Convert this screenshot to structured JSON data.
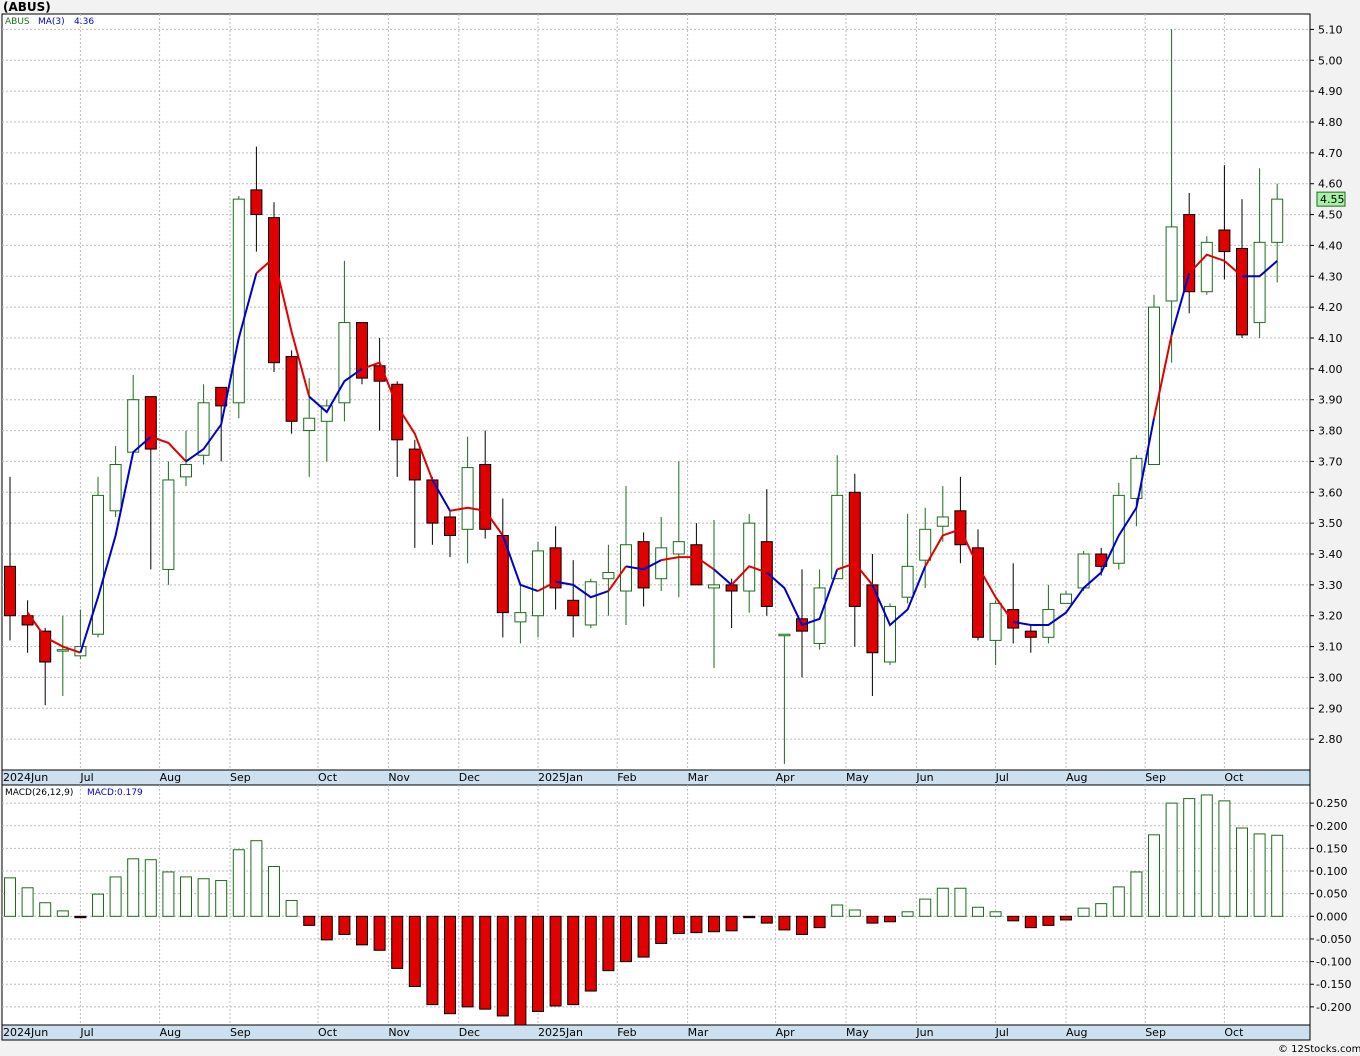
{
  "chart_data": [
    {
      "type": "candlestick",
      "title": "(ABUS)",
      "symbol_label": "ABUS",
      "ma_label": "MA(3)",
      "ma_value": "4.36",
      "last_price": "4.55",
      "interval": "weekly",
      "ylim": [
        2.7,
        5.15
      ],
      "y_ticks": [
        "2.80",
        "2.90",
        "3.00",
        "3.10",
        "3.20",
        "3.30",
        "3.40",
        "3.50",
        "3.60",
        "3.70",
        "3.80",
        "3.90",
        "4.00",
        "4.10",
        "4.20",
        "4.30",
        "4.40",
        "4.50",
        "4.60",
        "4.70",
        "4.80",
        "4.90",
        "5.00",
        "5.10"
      ],
      "months": [
        {
          "label": "2024Jun",
          "week": -0.5
        },
        {
          "label": "Jul",
          "week": 4
        },
        {
          "label": "Aug",
          "week": 8.5
        },
        {
          "label": "Sep",
          "week": 12.5
        },
        {
          "label": "Oct",
          "week": 17.5
        },
        {
          "label": "Nov",
          "week": 21.5
        },
        {
          "label": "Dec",
          "week": 25.5
        },
        {
          "label": "2025Jan",
          "week": 30
        },
        {
          "label": "Feb",
          "week": 34.5
        },
        {
          "label": "Mar",
          "week": 38.5
        },
        {
          "label": "Apr",
          "week": 43.5
        },
        {
          "label": "May",
          "week": 47.5
        },
        {
          "label": "Jun",
          "week": 51.5
        },
        {
          "label": "Jul",
          "week": 56
        },
        {
          "label": "Aug",
          "week": 60
        },
        {
          "label": "Sep",
          "week": 64.5
        },
        {
          "label": "Oct",
          "week": 69
        }
      ],
      "colors": {
        "up": "#1a6e1a",
        "down": "#e00000",
        "ma_up": "#0000cc",
        "ma_down": "#e00000",
        "macd_up": "#1a6e1a",
        "macd_down": "#e00000",
        "grid": "#bbbbbb",
        "axis_bar": "#cce0f0",
        "last_box": "#a8f0a8"
      },
      "candles": [
        [
          3.36,
          3.65,
          3.12,
          3.2
        ],
        [
          3.2,
          3.25,
          3.08,
          3.17
        ],
        [
          3.15,
          3.16,
          2.91,
          3.05
        ],
        [
          3.09,
          3.2,
          2.94,
          3.09
        ],
        [
          3.07,
          3.22,
          3.06,
          3.1
        ],
        [
          3.14,
          3.65,
          3.13,
          3.59
        ],
        [
          3.54,
          3.75,
          3.52,
          3.69
        ],
        [
          3.73,
          3.98,
          3.73,
          3.9
        ],
        [
          3.91,
          3.91,
          3.35,
          3.74
        ],
        [
          3.35,
          3.7,
          3.3,
          3.64
        ],
        [
          3.65,
          3.8,
          3.62,
          3.69
        ],
        [
          3.72,
          3.95,
          3.69,
          3.89
        ],
        [
          3.94,
          3.94,
          3.7,
          3.88
        ],
        [
          3.89,
          4.56,
          3.84,
          4.55
        ],
        [
          4.58,
          4.72,
          4.38,
          4.5
        ],
        [
          4.49,
          4.54,
          3.99,
          4.02
        ],
        [
          4.04,
          4.06,
          3.79,
          3.83
        ],
        [
          3.8,
          3.97,
          3.65,
          3.84
        ],
        [
          3.83,
          3.9,
          3.7,
          3.88
        ],
        [
          3.89,
          4.35,
          3.83,
          4.15
        ],
        [
          4.15,
          4.15,
          3.95,
          3.97
        ],
        [
          4.01,
          4.1,
          3.8,
          3.96
        ],
        [
          3.95,
          3.96,
          3.65,
          3.77
        ],
        [
          3.74,
          3.77,
          3.42,
          3.64
        ],
        [
          3.64,
          3.65,
          3.43,
          3.5
        ],
        [
          3.52,
          3.54,
          3.39,
          3.46
        ],
        [
          3.48,
          3.78,
          3.37,
          3.68
        ],
        [
          3.69,
          3.8,
          3.45,
          3.48
        ],
        [
          3.46,
          3.58,
          3.13,
          3.21
        ],
        [
          3.18,
          3.3,
          3.11,
          3.21
        ],
        [
          3.2,
          3.44,
          3.13,
          3.41
        ],
        [
          3.42,
          3.49,
          3.22,
          3.29
        ],
        [
          3.25,
          3.38,
          3.13,
          3.2
        ],
        [
          3.17,
          3.32,
          3.16,
          3.31
        ],
        [
          3.32,
          3.43,
          3.2,
          3.34
        ],
        [
          3.28,
          3.62,
          3.17,
          3.43
        ],
        [
          3.44,
          3.47,
          3.23,
          3.29
        ],
        [
          3.32,
          3.52,
          3.28,
          3.42
        ],
        [
          3.4,
          3.7,
          3.26,
          3.44
        ],
        [
          3.43,
          3.5,
          3.3,
          3.3
        ],
        [
          3.29,
          3.51,
          3.03,
          3.3
        ],
        [
          3.3,
          3.32,
          3.16,
          3.28
        ],
        [
          3.28,
          3.53,
          3.21,
          3.5
        ],
        [
          3.44,
          3.61,
          3.2,
          3.23
        ],
        [
          3.14,
          3.14,
          2.72,
          3.14
        ],
        [
          3.19,
          3.35,
          3.0,
          3.15
        ],
        [
          3.11,
          3.35,
          3.09,
          3.29
        ],
        [
          3.32,
          3.72,
          3.32,
          3.59
        ],
        [
          3.6,
          3.66,
          3.1,
          3.23
        ],
        [
          3.3,
          3.4,
          2.94,
          3.08
        ],
        [
          3.05,
          3.24,
          3.04,
          3.23
        ],
        [
          3.26,
          3.53,
          3.24,
          3.36
        ],
        [
          3.38,
          3.55,
          3.29,
          3.48
        ],
        [
          3.49,
          3.62,
          3.44,
          3.52
        ],
        [
          3.54,
          3.65,
          3.37,
          3.43
        ],
        [
          3.42,
          3.48,
          3.12,
          3.13
        ],
        [
          3.12,
          3.25,
          3.04,
          3.24
        ],
        [
          3.22,
          3.37,
          3.11,
          3.16
        ],
        [
          3.15,
          3.17,
          3.08,
          3.13
        ],
        [
          3.13,
          3.3,
          3.11,
          3.22
        ],
        [
          3.24,
          3.28,
          3.24,
          3.27
        ],
        [
          3.29,
          3.41,
          3.28,
          3.4
        ],
        [
          3.4,
          3.42,
          3.33,
          3.36
        ],
        [
          3.37,
          3.63,
          3.35,
          3.59
        ],
        [
          3.58,
          3.72,
          3.49,
          3.71
        ],
        [
          3.69,
          4.24,
          3.69,
          4.2
        ],
        [
          4.22,
          5.1,
          4.02,
          4.46
        ],
        [
          4.5,
          4.57,
          4.18,
          4.25
        ],
        [
          4.25,
          4.43,
          4.24,
          4.41
        ],
        [
          4.45,
          4.66,
          4.29,
          4.38
        ],
        [
          4.39,
          4.55,
          4.1,
          4.11
        ],
        [
          4.15,
          4.65,
          4.1,
          4.41
        ],
        [
          4.41,
          4.6,
          4.28,
          4.55
        ]
      ],
      "ma": [
        [
          1,
          3.21
        ],
        [
          2,
          3.13
        ],
        [
          3,
          3.1
        ],
        [
          4,
          3.08
        ],
        [
          5,
          3.26
        ],
        [
          6,
          3.46
        ],
        [
          7,
          3.73
        ],
        [
          8,
          3.78
        ],
        [
          9,
          3.76
        ],
        [
          10,
          3.7
        ],
        [
          11,
          3.74
        ],
        [
          12,
          3.82
        ],
        [
          13,
          4.1
        ],
        [
          14,
          4.31
        ],
        [
          15,
          4.36
        ],
        [
          16,
          4.12
        ],
        [
          17,
          3.91
        ],
        [
          18,
          3.86
        ],
        [
          19,
          3.96
        ],
        [
          20,
          4.0
        ],
        [
          21,
          4.02
        ],
        [
          22,
          3.88
        ],
        [
          23,
          3.79
        ],
        [
          24,
          3.64
        ],
        [
          25,
          3.54
        ],
        [
          26,
          3.55
        ],
        [
          27,
          3.54
        ],
        [
          28,
          3.46
        ],
        [
          29,
          3.3
        ],
        [
          30,
          3.28
        ],
        [
          31,
          3.31
        ],
        [
          32,
          3.3
        ],
        [
          33,
          3.26
        ],
        [
          34,
          3.28
        ],
        [
          35,
          3.36
        ],
        [
          36,
          3.35
        ],
        [
          37,
          3.38
        ],
        [
          38,
          3.39
        ],
        [
          39,
          3.39
        ],
        [
          40,
          3.35
        ],
        [
          41,
          3.3
        ],
        [
          42,
          3.36
        ],
        [
          43,
          3.34
        ],
        [
          44,
          3.29
        ],
        [
          45,
          3.17
        ],
        [
          46,
          3.19
        ],
        [
          47,
          3.35
        ],
        [
          48,
          3.37
        ],
        [
          49,
          3.3
        ],
        [
          50,
          3.17
        ],
        [
          51,
          3.22
        ],
        [
          52,
          3.36
        ],
        [
          53,
          3.46
        ],
        [
          54,
          3.48
        ],
        [
          55,
          3.36
        ],
        [
          56,
          3.26
        ],
        [
          57,
          3.18
        ],
        [
          58,
          3.17
        ],
        [
          59,
          3.17
        ],
        [
          60,
          3.21
        ],
        [
          61,
          3.29
        ],
        [
          62,
          3.34
        ],
        [
          63,
          3.46
        ],
        [
          64,
          3.55
        ],
        [
          65,
          3.84
        ],
        [
          66,
          4.11
        ],
        [
          67,
          4.31
        ],
        [
          68,
          4.37
        ],
        [
          69,
          4.35
        ],
        [
          70,
          4.3
        ],
        [
          71,
          4.3
        ],
        [
          72,
          4.35
        ]
      ],
      "ma_dir": [
        [
          "d",
          0,
          4
        ],
        [
          "u",
          4,
          8
        ],
        [
          "d",
          8,
          10
        ],
        [
          "u",
          10,
          14
        ],
        [
          "d",
          14,
          17
        ],
        [
          "u",
          17,
          20
        ],
        [
          "d",
          20,
          24
        ],
        [
          "u",
          24,
          25
        ],
        [
          "d",
          25,
          28
        ],
        [
          "u",
          28,
          30
        ],
        [
          "d",
          30,
          31
        ],
        [
          "u",
          31,
          34
        ],
        [
          "d",
          34,
          35
        ],
        [
          "u",
          35,
          37
        ],
        [
          "d",
          37,
          40
        ],
        [
          "u",
          40,
          41
        ],
        [
          "d",
          41,
          43
        ],
        [
          "u",
          43,
          47
        ],
        [
          "d",
          47,
          49
        ],
        [
          "u",
          49,
          52
        ],
        [
          "d",
          52,
          57
        ],
        [
          "u",
          57,
          65
        ],
        [
          "d",
          65,
          66
        ],
        [
          "u",
          66,
          67
        ],
        [
          "d",
          67,
          70
        ],
        [
          "u",
          70,
          72
        ]
      ]
    },
    {
      "type": "bar",
      "label": "MACD(26,12,9)",
      "value_label": "MACD:0.179",
      "ylim": [
        -0.24,
        0.29
      ],
      "y_ticks": [
        "-0.200",
        "-0.150",
        "-0.100",
        "-0.050",
        "0.000",
        "0.050",
        "0.100",
        "0.150",
        "0.200",
        "0.250"
      ],
      "values": [
        0.085,
        0.063,
        0.03,
        0.012,
        -0.003,
        0.049,
        0.087,
        0.127,
        0.125,
        0.098,
        0.087,
        0.083,
        0.079,
        0.147,
        0.167,
        0.11,
        0.035,
        -0.02,
        -0.052,
        -0.04,
        -0.063,
        -0.075,
        -0.115,
        -0.155,
        -0.195,
        -0.215,
        -0.2,
        -0.205,
        -0.22,
        -0.243,
        -0.21,
        -0.198,
        -0.195,
        -0.165,
        -0.12,
        -0.1,
        -0.09,
        -0.06,
        -0.038,
        -0.036,
        -0.034,
        -0.032,
        -0.003,
        -0.015,
        -0.03,
        -0.04,
        -0.025,
        0.025,
        0.014,
        -0.015,
        -0.012,
        0.01,
        0.038,
        0.062,
        0.062,
        0.02,
        0.01,
        -0.01,
        -0.025,
        -0.02,
        -0.008,
        0.018,
        0.028,
        0.065,
        0.098,
        0.18,
        0.25,
        0.26,
        0.268,
        0.255,
        0.195,
        0.182,
        0.179
      ]
    }
  ],
  "credit": "© 12Stocks.com"
}
